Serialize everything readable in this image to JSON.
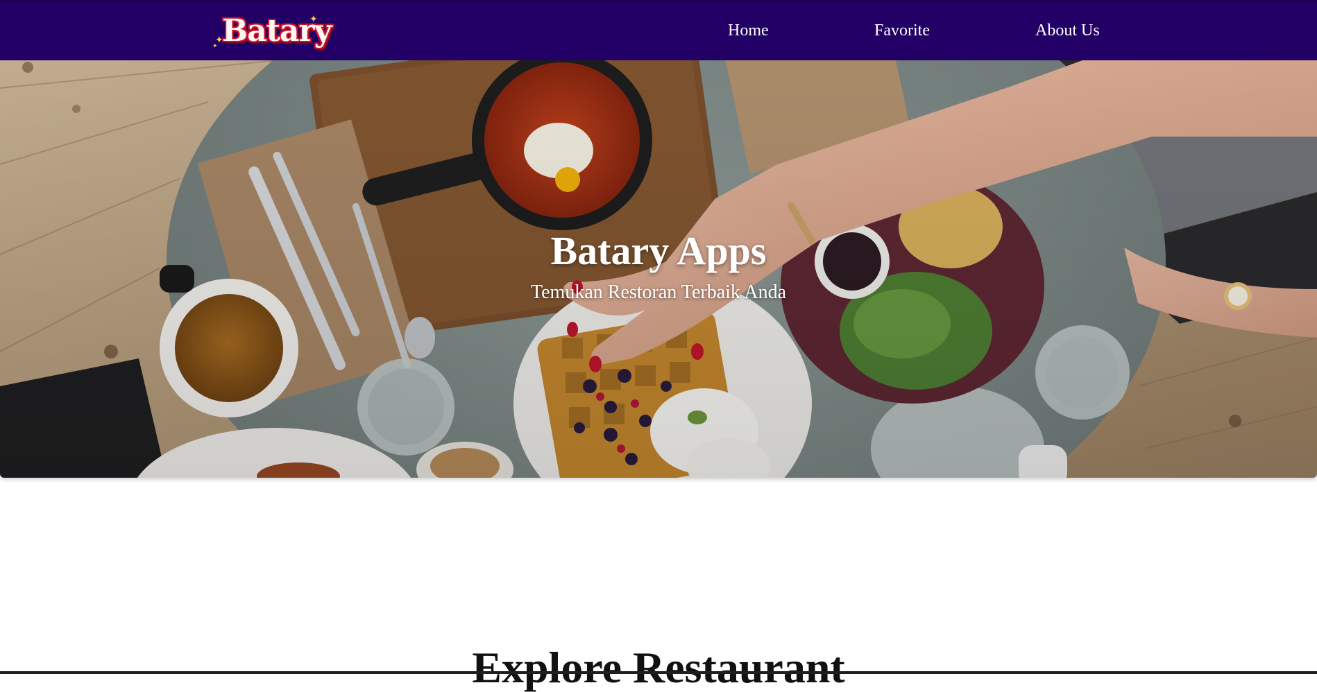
{
  "nav": {
    "logo_text": "Batary",
    "links": [
      "Home",
      "Favorite",
      "About Us"
    ]
  },
  "hero": {
    "title": "Batary Apps",
    "subtitle": "Temukan Restoran Terbaik Anda"
  },
  "main": {
    "section_title": "Explore Restaurant"
  },
  "colors": {
    "navbar": "#230066",
    "logo_fill": "#fff7f2",
    "logo_outline": "#c8102e",
    "text_light": "#ffffff",
    "heading_dark": "#111111"
  },
  "icons": {
    "logo_sparkles": "sparkle-icon"
  }
}
